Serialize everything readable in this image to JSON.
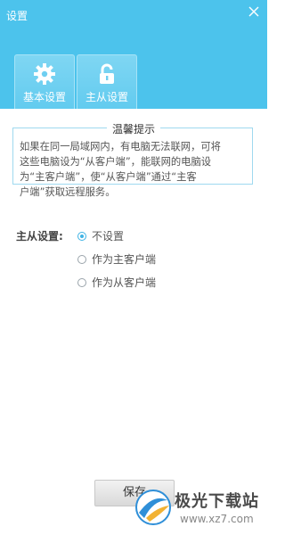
{
  "window": {
    "title": "设置"
  },
  "tabs": [
    {
      "label": "基本设置",
      "icon": "gear-icon"
    },
    {
      "label": "主从设置",
      "icon": "unlock-icon"
    }
  ],
  "notice": {
    "title": "温馨提示",
    "lines": [
      "如果在同一局域网内，有电脑无法联网，可将",
      "这些电脑设为“从客户端”，能联网的电脑设",
      "为“主客户端”，使“从客户端”通过“主客",
      "户端”获取远程服务。"
    ]
  },
  "master_slave": {
    "label": "主从设置:",
    "options": [
      {
        "label": "不设置",
        "checked": true
      },
      {
        "label": "作为主客户端",
        "checked": false
      },
      {
        "label": "作为从客户端",
        "checked": false
      }
    ]
  },
  "save_button": "保存",
  "watermark": {
    "name": "极光下载站",
    "url": "www.xz7.com"
  },
  "colors": {
    "header": "#4cc3ec",
    "accent": "#3fb3e4"
  }
}
